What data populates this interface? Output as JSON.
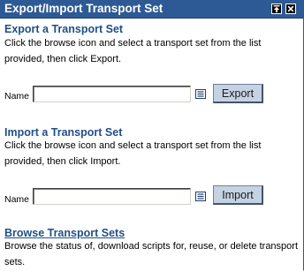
{
  "portlet": {
    "title": "Export/Import Transport Set",
    "buttons": {
      "to_top_icon": "arrow-to-top-icon",
      "close_icon": "close-icon"
    }
  },
  "export_section": {
    "heading": "Export a Transport Set",
    "description": "Click the browse icon and select a transport set from the list provided, then click Export.",
    "name_label": "Name",
    "name_value": "",
    "browse_icon": "list-browse-icon",
    "button_label": "Export"
  },
  "import_section": {
    "heading": "Import a Transport Set",
    "description": "Click the browse icon and select a transport set from the list provided, then click Import.",
    "name_label": "Name",
    "name_value": "",
    "browse_icon": "list-browse-icon",
    "button_label": "Import"
  },
  "browse_section": {
    "heading": "Browse Transport Sets",
    "description": "Browse the status of, download scripts for, reuse, or delete transport sets."
  },
  "colors": {
    "titlebar": "#2d5a95",
    "heading": "#1f4f86",
    "button_face": "#c5d2e2"
  }
}
